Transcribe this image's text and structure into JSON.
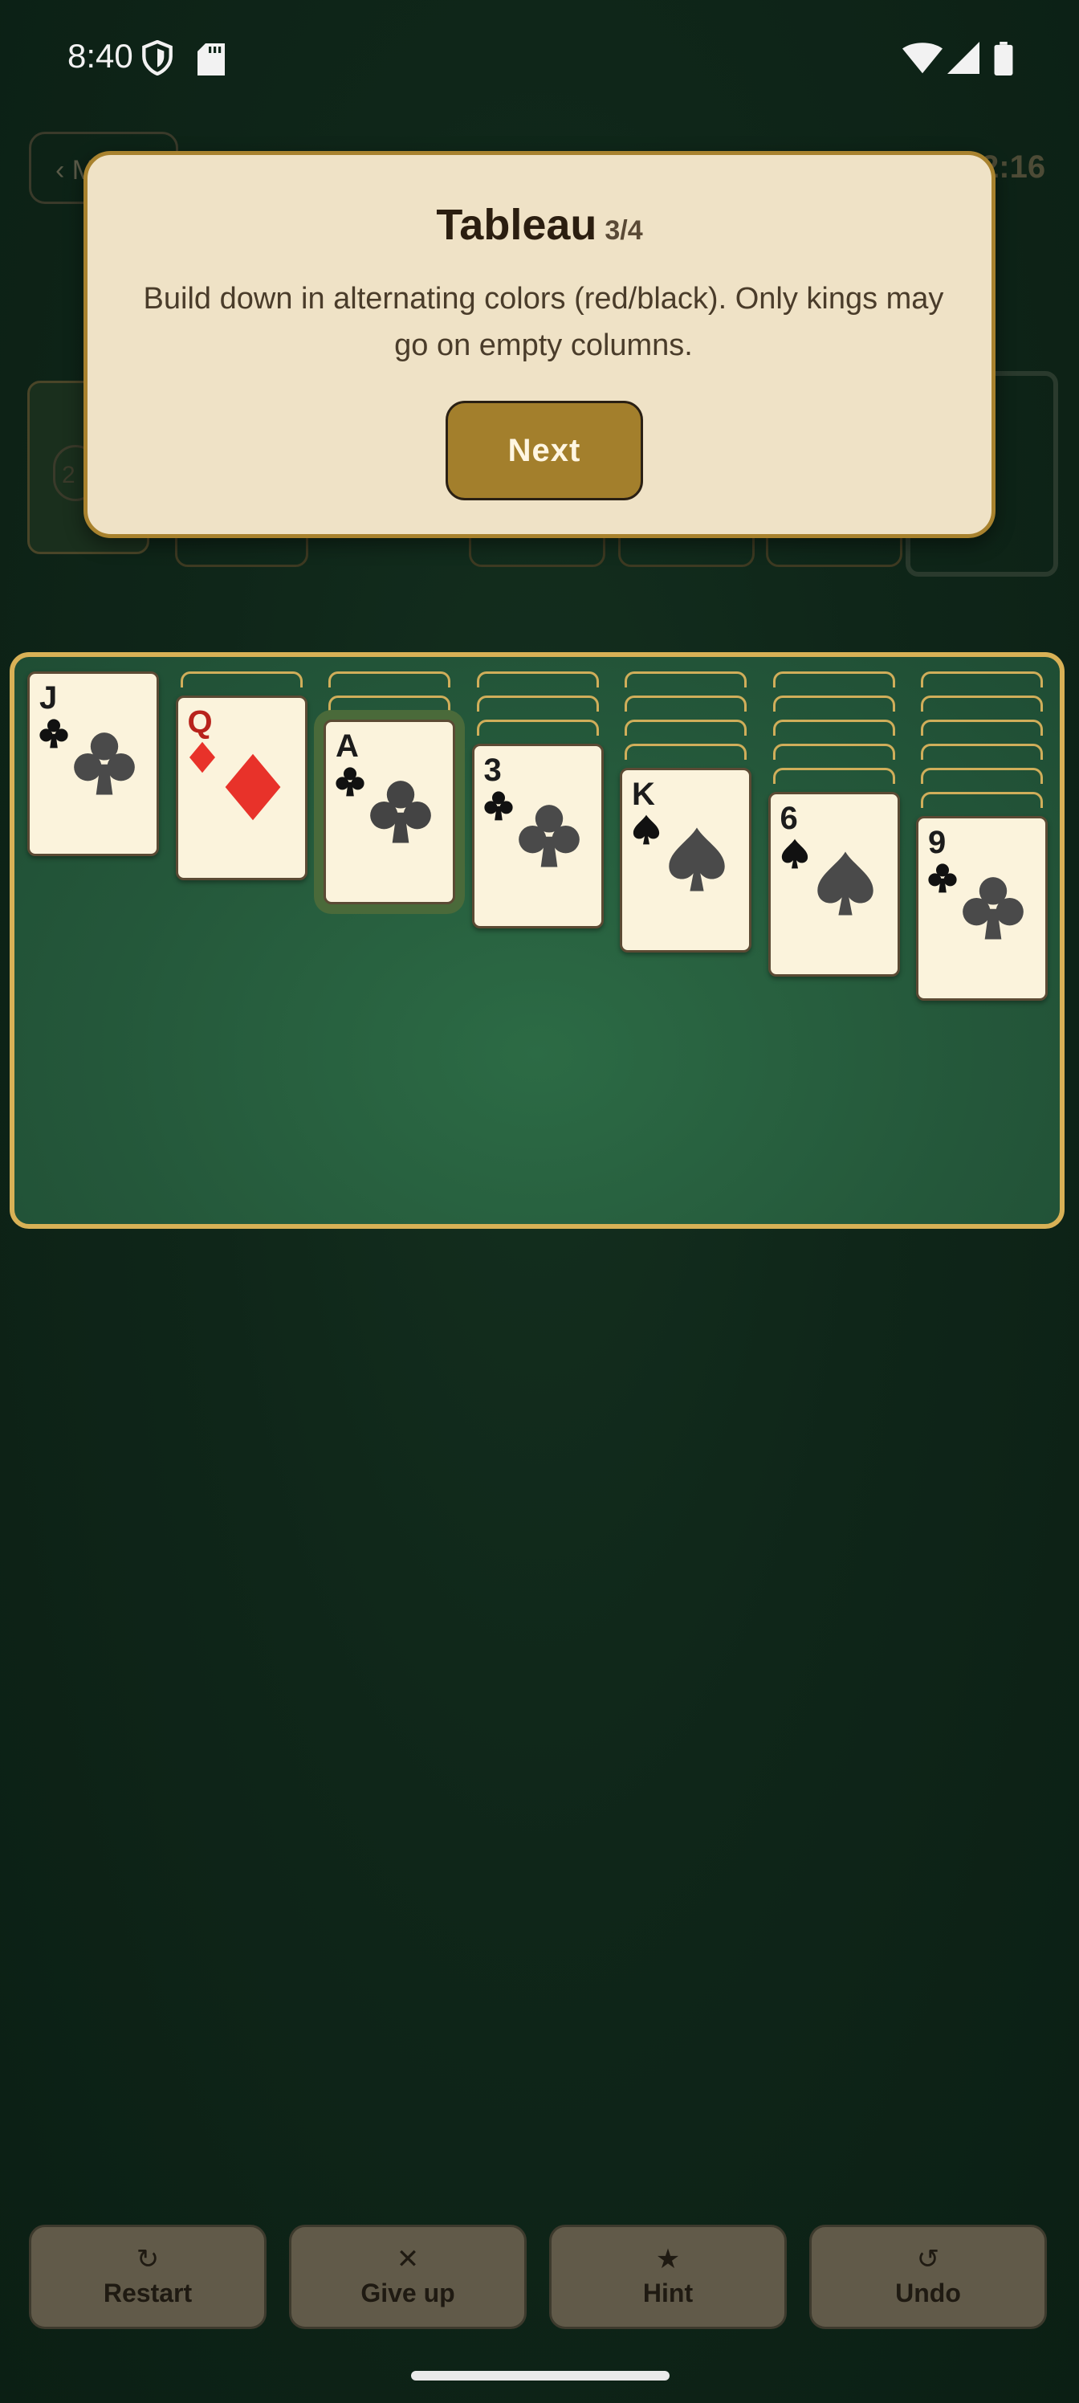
{
  "status_bar": {
    "time": "8:40"
  },
  "top_bar": {
    "menu_label": "‹ M",
    "timer": "2:16"
  },
  "stock": {
    "count": "2"
  },
  "tutorial": {
    "title": "Tableau",
    "step": "3/4",
    "body": "Build down in alternating colors (red/black). Only kings may go on empty columns.",
    "next_label": "Next"
  },
  "tableau": {
    "columns": [
      {
        "facedown": 0,
        "card": {
          "rank": "J",
          "suit": "clubs",
          "color": "black"
        }
      },
      {
        "facedown": 1,
        "card": {
          "rank": "Q",
          "suit": "diamonds",
          "color": "red"
        }
      },
      {
        "facedown": 2,
        "card": {
          "rank": "A",
          "suit": "clubs",
          "color": "black",
          "highlighted": true
        }
      },
      {
        "facedown": 3,
        "card": {
          "rank": "3",
          "suit": "clubs",
          "color": "black"
        }
      },
      {
        "facedown": 4,
        "card": {
          "rank": "K",
          "suit": "spades",
          "color": "black"
        }
      },
      {
        "facedown": 5,
        "card": {
          "rank": "6",
          "suit": "spades",
          "color": "black"
        }
      },
      {
        "facedown": 6,
        "card": {
          "rank": "9",
          "suit": "clubs",
          "color": "black"
        }
      }
    ]
  },
  "bottom_buttons": [
    {
      "label": "Restart",
      "icon": "↻",
      "icon_name": "restart-icon"
    },
    {
      "label": "Give up",
      "icon": "✕",
      "icon_name": "close-icon"
    },
    {
      "label": "Hint",
      "icon": "★",
      "icon_name": "star-icon"
    },
    {
      "label": "Undo",
      "icon": "↺",
      "icon_name": "undo-icon"
    }
  ],
  "colors": {
    "felt": "#2c6b45",
    "tableau_border": "#d8b156",
    "tutorial_bg": "#efe2c6",
    "next_button": "#a37f2c",
    "red_suit": "#e8322a",
    "black_suit": "#111111"
  }
}
